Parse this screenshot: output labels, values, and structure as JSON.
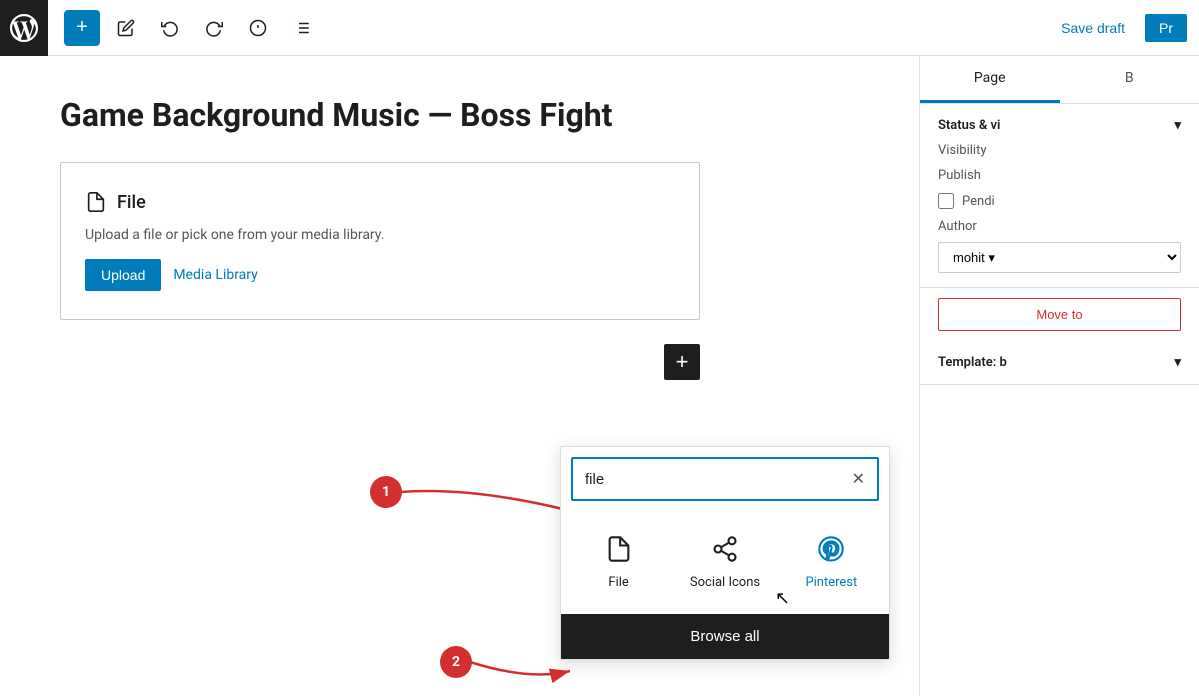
{
  "toolbar": {
    "add_label": "+",
    "save_draft_label": "Save draft",
    "publish_label": "Pr"
  },
  "page": {
    "title": "Game Background Music — Boss Fight"
  },
  "file_block": {
    "icon": "□",
    "title": "File",
    "description": "Upload a file or pick one from your media library.",
    "upload_label": "Upload",
    "media_library_label": "Media Library"
  },
  "add_block_btn": "+",
  "search_popup": {
    "placeholder": "file",
    "value": "file",
    "results": [
      {
        "id": "file",
        "icon": "□",
        "label": "File",
        "is_pinterest": false
      },
      {
        "id": "social-icons",
        "icon": "⇣",
        "label": "Social Icons",
        "is_pinterest": false
      },
      {
        "id": "pinterest",
        "icon": "𝙿",
        "label": "Pinterest",
        "is_pinterest": true
      }
    ],
    "browse_all_label": "Browse all"
  },
  "sidebar": {
    "tabs": [
      {
        "id": "page",
        "label": "Page",
        "active": true
      },
      {
        "id": "block",
        "label": "B"
      }
    ],
    "status_section": {
      "title": "Status & vi",
      "visibility_label": "Visibility",
      "publish_label": "Publish",
      "pending_label": "Pendi",
      "author_label": "Author",
      "author_value": "mohit"
    },
    "move_to_trash_label": "Move to",
    "template_section": {
      "label": "Template: b"
    }
  },
  "annotations": {
    "circle_1": "1",
    "circle_2": "2"
  }
}
